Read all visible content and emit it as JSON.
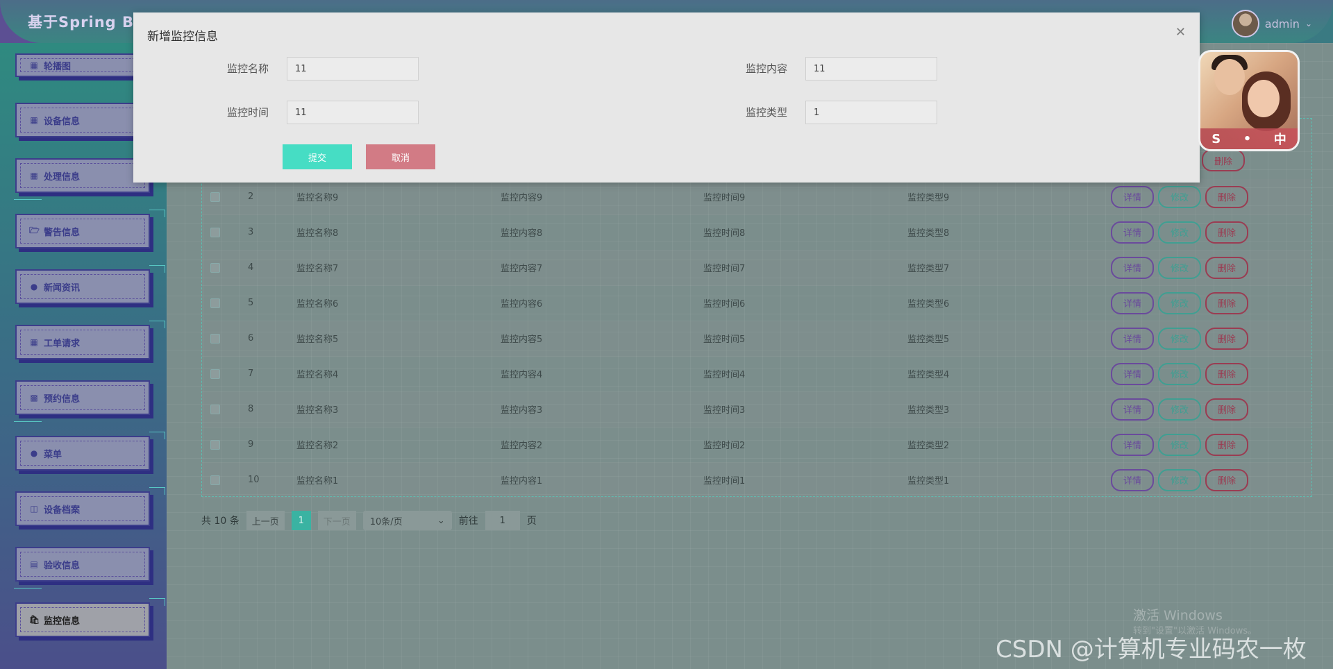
{
  "header": {
    "app_title": "基于Spring Boo",
    "user_name": "admin",
    "user_menu_icon": "chevron-down-icon"
  },
  "sidebar": {
    "items": [
      {
        "label": "轮播图",
        "icon": "grid-icon"
      },
      {
        "label": "设备信息",
        "icon": "grid-icon"
      },
      {
        "label": "处理信息",
        "icon": "grid-icon"
      },
      {
        "label": "警告信息",
        "icon": "folder-icon"
      },
      {
        "label": "新闻资讯",
        "icon": "drop-icon"
      },
      {
        "label": "工单请求",
        "icon": "grid-icon"
      },
      {
        "label": "预约信息",
        "icon": "cake-icon"
      },
      {
        "label": "菜单",
        "icon": "circle-icon"
      },
      {
        "label": "设备档案",
        "icon": "database-icon"
      },
      {
        "label": "验收信息",
        "icon": "server-icon"
      },
      {
        "label": "监控信息",
        "icon": "bag-icon",
        "active": true
      }
    ]
  },
  "table": {
    "rows": [
      {
        "idx": "2",
        "name": "监控名称9",
        "content": "监控内容9",
        "time": "监控时间9",
        "type": "监控类型9"
      },
      {
        "idx": "3",
        "name": "监控名称8",
        "content": "监控内容8",
        "time": "监控时间8",
        "type": "监控类型8"
      },
      {
        "idx": "4",
        "name": "监控名称7",
        "content": "监控内容7",
        "time": "监控时间7",
        "type": "监控类型7"
      },
      {
        "idx": "5",
        "name": "监控名称6",
        "content": "监控内容6",
        "time": "监控时间6",
        "type": "监控类型6"
      },
      {
        "idx": "6",
        "name": "监控名称5",
        "content": "监控内容5",
        "time": "监控时间5",
        "type": "监控类型5"
      },
      {
        "idx": "7",
        "name": "监控名称4",
        "content": "监控内容4",
        "time": "监控时间4",
        "type": "监控类型4"
      },
      {
        "idx": "8",
        "name": "监控名称3",
        "content": "监控内容3",
        "time": "监控时间3",
        "type": "监控类型3"
      },
      {
        "idx": "9",
        "name": "监控名称2",
        "content": "监控内容2",
        "time": "监控时间2",
        "type": "监控类型2"
      },
      {
        "idx": "10",
        "name": "监控名称1",
        "content": "监控内容1",
        "time": "监控时间1",
        "type": "监控类型1"
      }
    ],
    "ops": {
      "detail": "详情",
      "edit": "修改",
      "delete": "删除"
    },
    "partial_delete_label": "删除"
  },
  "pagination": {
    "total": "共 10 条",
    "prev": "上一页",
    "current": "1",
    "next": "下一页",
    "page_size": "10条/页",
    "goto_prefix": "前往",
    "goto_value": "1",
    "goto_suffix": "页"
  },
  "modal": {
    "title": "新增监控信息",
    "close_icon": "close-icon",
    "fields": {
      "name_label": "监控名称",
      "name_value": "11",
      "content_label": "监控内容",
      "content_value": "11",
      "time_label": "监控时间",
      "time_value": "11",
      "type_label": "监控类型",
      "type_value": "1"
    },
    "submit": "提交",
    "cancel": "取消"
  },
  "widget": {
    "bar_text": [
      "S",
      "•",
      "中"
    ]
  },
  "watermarks": {
    "windows_line1": "激活 Windows",
    "windows_line2": "转到\"设置\"以激活 Windows。",
    "csdn": "CSDN @计算机专业码农一枚"
  }
}
